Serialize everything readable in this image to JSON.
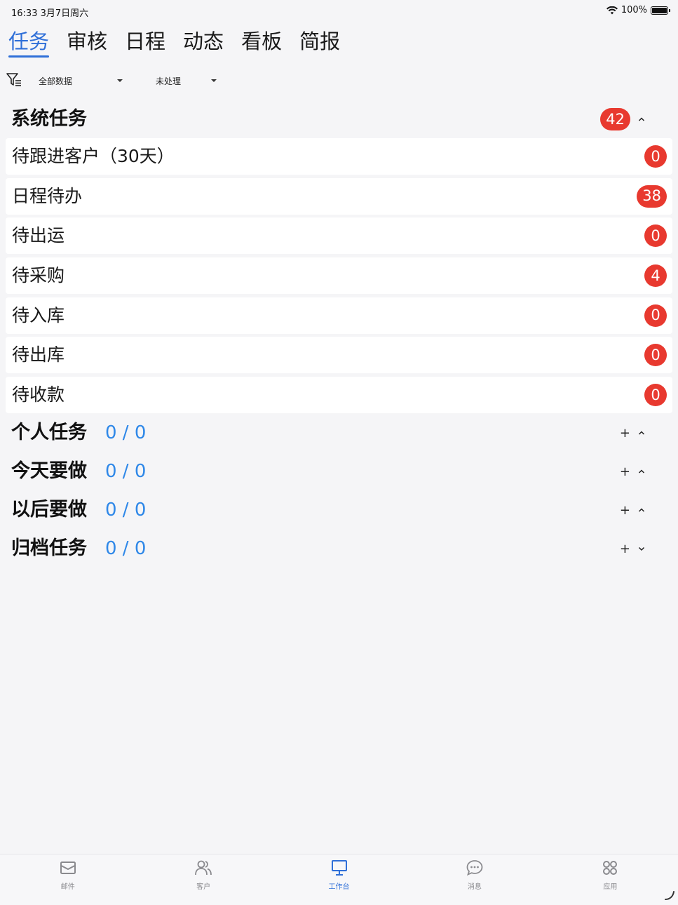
{
  "status_bar": {
    "time_date": "16:33  3月7日周六",
    "battery": "100%"
  },
  "top_tabs": [
    {
      "label": "任务",
      "active": true
    },
    {
      "label": "审核",
      "active": false
    },
    {
      "label": "日程",
      "active": false
    },
    {
      "label": "动态",
      "active": false
    },
    {
      "label": "看板",
      "active": false
    },
    {
      "label": "简报",
      "active": false
    }
  ],
  "filters": {
    "scope": "全部数据",
    "state": "未处理"
  },
  "system_section": {
    "title": "系统任务",
    "badge": "42"
  },
  "system_tasks": [
    {
      "label": "待跟进客户（30天）",
      "count": "0"
    },
    {
      "label": "日程待办",
      "count": "38"
    },
    {
      "label": "待出运",
      "count": "0"
    },
    {
      "label": "待采购",
      "count": "4"
    },
    {
      "label": "待入库",
      "count": "0"
    },
    {
      "label": "待出库",
      "count": "0"
    },
    {
      "label": "待收款",
      "count": "0"
    }
  ],
  "personal_sections": [
    {
      "title": "个人任务",
      "count": "0 / 0",
      "add": "+",
      "expanded": true
    },
    {
      "title": "今天要做",
      "count": "0 / 0",
      "add": "+",
      "expanded": true
    },
    {
      "title": "以后要做",
      "count": "0 / 0",
      "add": "+",
      "expanded": true
    },
    {
      "title": "归档任务",
      "count": "0 / 0",
      "add": "+",
      "expanded": false
    }
  ],
  "bottom_tabs": [
    {
      "label": "邮件",
      "icon": "mail-icon",
      "active": false
    },
    {
      "label": "客户",
      "icon": "users-icon",
      "active": false
    },
    {
      "label": "工作台",
      "icon": "monitor-icon",
      "active": true
    },
    {
      "label": "消息",
      "icon": "chat-icon",
      "active": false
    },
    {
      "label": "应用",
      "icon": "apps-icon",
      "active": false
    }
  ],
  "colors": {
    "accent": "#2f6fd8",
    "count_blue": "#2f88e8",
    "badge_red": "#e8392f"
  }
}
